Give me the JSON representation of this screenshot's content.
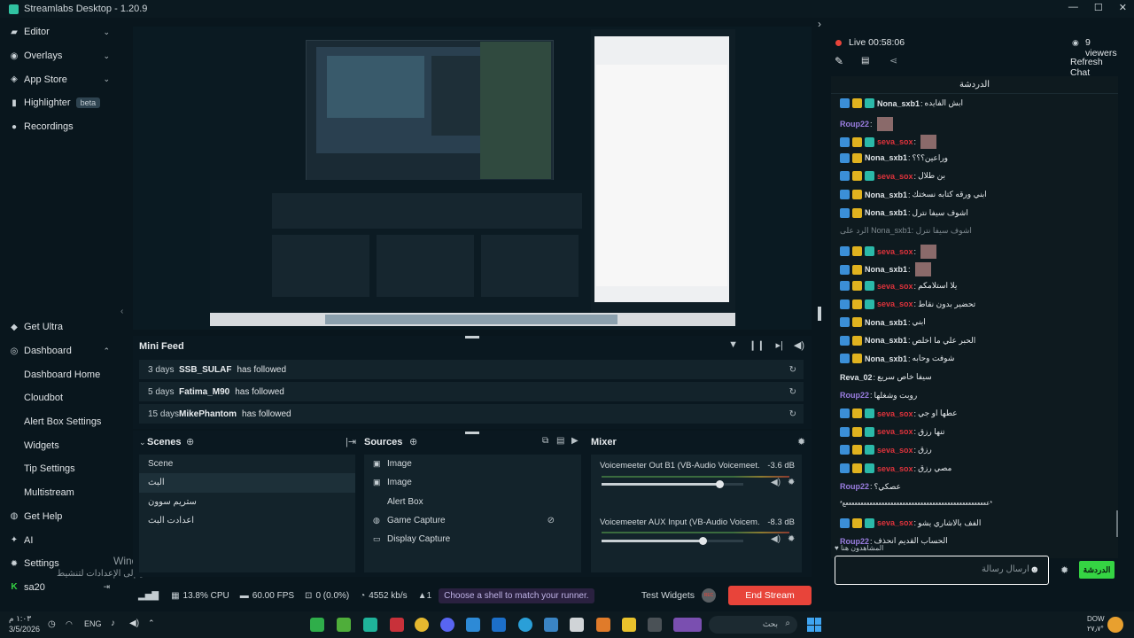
{
  "window": {
    "title": "Streamlabs Desktop - 1.20.9",
    "controls": [
      "—",
      "☐",
      "✕"
    ]
  },
  "sidebar": {
    "top_items": [
      {
        "label": "Editor",
        "icon": "brush-icon",
        "chevron": "⌄"
      },
      {
        "label": "Overlays",
        "icon": "compass-icon",
        "chevron": "⌄"
      },
      {
        "label": "App Store",
        "icon": "store-icon",
        "chevron": "⌄"
      },
      {
        "label": "Highlighter",
        "icon": "highlighter-icon",
        "badge": "beta"
      },
      {
        "label": "Recordings",
        "icon": "record-icon"
      }
    ],
    "bottom_items": [
      {
        "label": "Get Ultra",
        "icon": "ultra-icon"
      },
      {
        "label": "Dashboard",
        "icon": "dashboard-icon",
        "chevron": "⌃"
      },
      {
        "label": "Dashboard Home",
        "sub": true
      },
      {
        "label": "Cloudbot",
        "sub": true
      },
      {
        "label": "Alert Box Settings",
        "sub": true
      },
      {
        "label": "Widgets",
        "sub": true
      },
      {
        "label": "Tip Settings",
        "sub": true
      },
      {
        "label": "Multistream",
        "sub": true
      },
      {
        "label": "Get Help",
        "icon": "help-icon"
      },
      {
        "label": "AI",
        "icon": "ai-icon"
      },
      {
        "label": "Settings",
        "icon": "gear-icon"
      },
      {
        "label": "sa20",
        "icon": "kick-icon"
      }
    ],
    "watermark_line1": "Windows تنشيط",
    "watermark_line2": "انتقل إلى الإعدادات لتنشيط Windows."
  },
  "minifeed": {
    "title": "Mini Feed",
    "rows": [
      {
        "time": "3 days",
        "user": "SSB_SULAF",
        "action": "has followed"
      },
      {
        "time": "5 days",
        "user": "Fatima_M90",
        "action": "has followed"
      },
      {
        "time": "15 days",
        "user": "MikePhantom",
        "action": "has followed"
      }
    ]
  },
  "scenes": {
    "title": "Scenes",
    "items": [
      "Scene",
      "البث",
      "ستريم سوون",
      "اعدادت البث"
    ],
    "selected": 1
  },
  "sources": {
    "title": "Sources",
    "items": [
      {
        "label": "Image",
        "icon": "image-icon"
      },
      {
        "label": "Image",
        "icon": "image-icon"
      },
      {
        "label": "Alert Box",
        "icon": "alert-icon"
      },
      {
        "label": "Game Capture",
        "icon": "gamepad-icon"
      },
      {
        "label": "Display Capture",
        "icon": "monitor-icon"
      }
    ]
  },
  "mixer": {
    "title": "Mixer",
    "channels": [
      {
        "name": "Voicemeeter Out B1 (VB-Audio Voicemeet...",
        "db": "-3.6 dB",
        "level": 0.83
      },
      {
        "name": "Voicemeeter AUX Input (VB-Audio Voicem...",
        "db": "-8.3 dB",
        "level": 0.71
      }
    ]
  },
  "statusbar": {
    "cpu": "13.8% CPU",
    "fps": "60.00 FPS",
    "dropped": "0 (0.0%)",
    "bitrate": "4552 kb/s",
    "alerts": "1",
    "promo": "Choose a shell to match your runner.",
    "test_widgets": "Test Widgets",
    "rec": "REC",
    "end_stream": "End Stream"
  },
  "live": {
    "status": "Live 00:58:06",
    "viewers": "9 viewers",
    "refresh": "Refresh Chat"
  },
  "chat": {
    "title": "الدردشة",
    "messages": [
      {
        "name": "Nona_sxb1",
        "text": "ابش الفايده",
        "badges": 3,
        "color": "white"
      },
      {
        "name": "Roup22",
        "text": "",
        "badges": 0,
        "color": "pur",
        "emote": true
      },
      {
        "name": "seva_sox",
        "text": "",
        "badges": 3,
        "color": "red",
        "emote": true
      },
      {
        "name": "Nona_sxb1",
        "text": "وراعين؟؟؟",
        "badges": 2,
        "color": "white"
      },
      {
        "name": "seva_sox",
        "text": "بن طلال",
        "badges": 3,
        "color": "red"
      },
      {
        "name": "Nona_sxb1",
        "text": "ابني ورقه كتابه نسختك",
        "badges": 2,
        "color": "white"
      },
      {
        "name": "Nona_sxb1",
        "text": "اشوف سيفا نترل",
        "badges": 2,
        "color": "white"
      },
      {
        "name": "",
        "text": "الرد على Nona_sxb1: اشوف سيفا نترل",
        "badges": 0,
        "color": "reply"
      },
      {
        "name": "seva_sox",
        "text": "",
        "badges": 3,
        "color": "red",
        "emote": true
      },
      {
        "name": "Nona_sxb1",
        "text": "",
        "badges": 2,
        "color": "white",
        "emote": true
      },
      {
        "name": "seva_sox",
        "text": "يلا استلامكم",
        "badges": 3,
        "color": "red"
      },
      {
        "name": "seva_sox",
        "text": "تحضير بدون نقاط",
        "badges": 3,
        "color": "red"
      },
      {
        "name": "Nona_sxb1",
        "text": "ابني",
        "badges": 2,
        "color": "white"
      },
      {
        "name": "Nona_sxb1",
        "text": "الحبر علي ما اخلص",
        "badges": 2,
        "color": "white"
      },
      {
        "name": "Nona_sxb1",
        "text": "شوفت وحابه",
        "badges": 2,
        "color": "white"
      },
      {
        "name": "Reva_02",
        "text": "سيفا خاص سريع",
        "badges": 0,
        "color": "white"
      },
      {
        "name": "Roup22",
        "text": "روبت وشغلها",
        "badges": 0,
        "color": "pur"
      },
      {
        "name": "seva_sox",
        "text": "عطها او جي",
        "badges": 3,
        "color": "red"
      },
      {
        "name": "seva_sox",
        "text": "تنها رزق",
        "badges": 3,
        "color": "red"
      },
      {
        "name": "seva_sox",
        "text": "رزق",
        "badges": 3,
        "color": "red"
      },
      {
        "name": "seva_sox",
        "text": "مصي رزق",
        "badges": 3,
        "color": "red"
      },
      {
        "name": "Roup22",
        "text": "عصكي؟",
        "badges": 0,
        "color": "pur"
      },
      {
        "name": "",
        "text": "*ععععععععععععععععععععععععععععععععععععععععععععععععع*",
        "badges": 0,
        "color": "plain"
      },
      {
        "name": "seva_sox",
        "text": "الفف بالاشاري يشو",
        "badges": 3,
        "color": "red"
      },
      {
        "name": "Roup22",
        "text": "الحساب القديم انحذف",
        "badges": 0,
        "color": "pur"
      }
    ],
    "typing": "المشاهدون هنا",
    "input_placeholder": "ارسال رسالة",
    "send_label": "الدردشة"
  },
  "taskbar": {
    "date": "3/5/2026",
    "time": "١:٠٣ م",
    "lang": "ENG",
    "search": "بحث",
    "weather": "DOW",
    "weather_temp": "٢٧٫٧°"
  },
  "colors": {
    "accent": "#31c3a2",
    "live": "#e8443a",
    "end": "#e8443a",
    "send": "#35d443"
  }
}
